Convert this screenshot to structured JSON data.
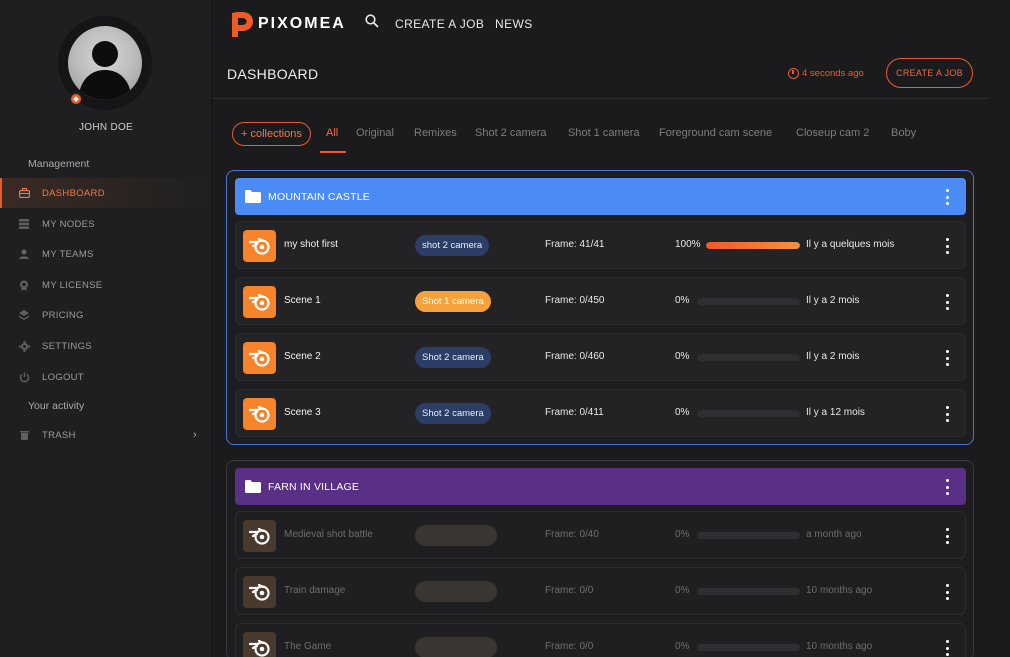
{
  "user": {
    "name": "JOHN DOE"
  },
  "sidebar": {
    "management_label": "Management",
    "items": [
      {
        "label": "DASHBOARD",
        "icon": "briefcase-icon",
        "active": true
      },
      {
        "label": "MY NODES",
        "icon": "server-icon"
      },
      {
        "label": "MY TEAMS",
        "icon": "users-icon"
      },
      {
        "label": "MY LICENSE",
        "icon": "license-icon"
      },
      {
        "label": "PRICING",
        "icon": "layers-icon"
      },
      {
        "label": "SETTINGS",
        "icon": "gear-icon"
      },
      {
        "label": "LOGOUT",
        "icon": "power-icon"
      }
    ],
    "activity_label": "Your activity",
    "trash": {
      "label": "TRASH",
      "icon": "trash-icon"
    }
  },
  "topbar": {
    "brand": "PIXOMEA",
    "create_job": "CREATE A JOB",
    "news": "NEWS"
  },
  "page": {
    "title": "DASHBOARD",
    "updated": "4 seconds ago",
    "create_button": "CREATE A JOB"
  },
  "tabs": {
    "collections_button": "+ collections",
    "items": [
      "All",
      "Original",
      "Remixes",
      "Shot 2 camera",
      "Shot 1 camera",
      "Foreground cam scene",
      "Closeup cam 2",
      "Boby"
    ],
    "active": "All"
  },
  "collections": [
    {
      "title": "MOUNTAIN CASTLE",
      "color": "#4a8bf5",
      "rows": [
        {
          "name": "my shot first",
          "tag": "shot 2 camera",
          "frame": "Frame: 41/41",
          "pct": "100%",
          "progress": 1.0,
          "time": "Il y a quelques mois"
        },
        {
          "name": "Scene 1",
          "tag": "Shot 1 camera",
          "frame": "Frame: 0/450",
          "pct": "0%",
          "progress": 0,
          "time": "Il y a 2 mois"
        },
        {
          "name": "Scene 2",
          "tag": "Shot 2 camera",
          "frame": "Frame: 0/460",
          "pct": "0%",
          "progress": 0,
          "time": "Il y a 2 mois"
        },
        {
          "name": "Scene 3",
          "tag": "Shot 2 camera",
          "frame": "Frame: 0/411",
          "pct": "0%",
          "progress": 0,
          "time": "Il y a 12 mois"
        }
      ]
    },
    {
      "title": "FARN IN VILLAGE",
      "color": "#5a2f86",
      "rows": [
        {
          "name": "Medieval shot battle",
          "tag": "",
          "frame": "Frame: 0/40",
          "pct": "0%",
          "progress": 0,
          "time": "a month ago"
        },
        {
          "name": "Train damage",
          "tag": "",
          "frame": "Frame: 0/0",
          "pct": "0%",
          "progress": 0,
          "time": "10 months ago"
        },
        {
          "name": "The Game",
          "tag": "",
          "frame": "Frame: 0/0",
          "pct": "0%",
          "progress": 0,
          "time": "10 months ago"
        }
      ]
    }
  ],
  "colors": {
    "accent": "#f05a28",
    "collection_border": "#4a73d6"
  }
}
